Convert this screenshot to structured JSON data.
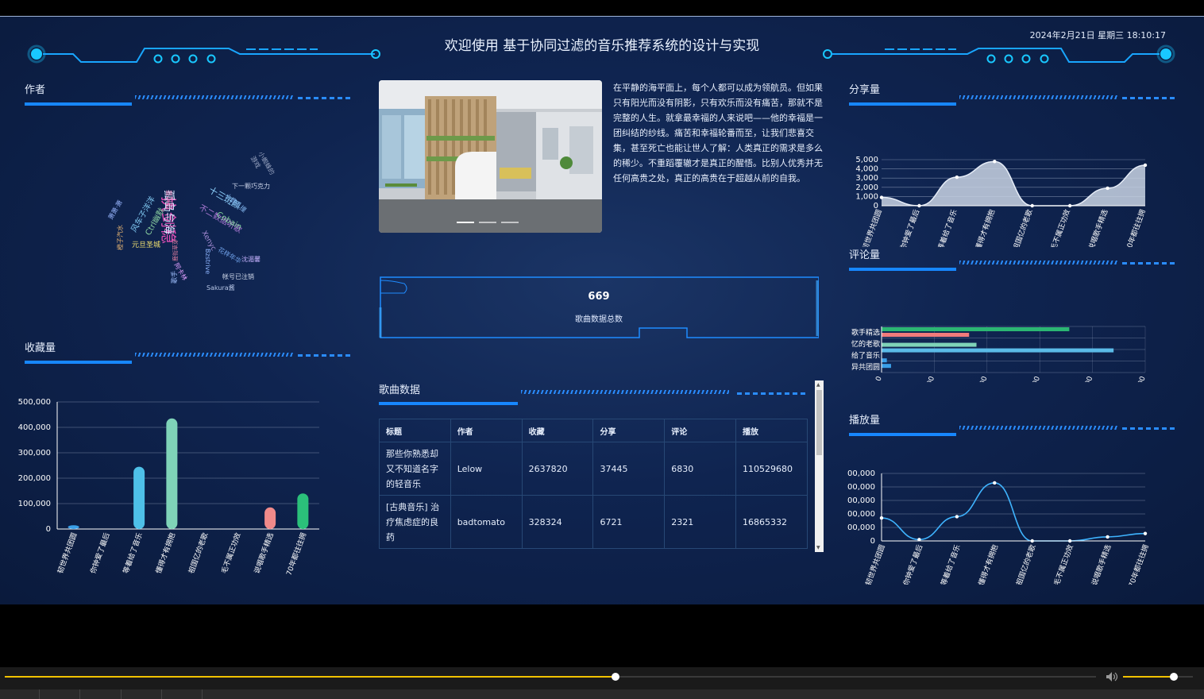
{
  "header": {
    "title": "欢迎使用 基于协同过滤的音乐推荐系统的设计与实现",
    "datetime": "2024年2月21日 星期三 18:10:17"
  },
  "panels": {
    "author": "作者",
    "favorites": "收藏量",
    "shares": "分享量",
    "comments": "评论量",
    "plays": "播放量",
    "song_data": "歌曲数据"
  },
  "description": "在平静的海平面上，每个人都可以成为领航员。但如果只有阳光而没有阴影，只有欢乐而没有痛苦，那就不是完整的人生。就拿最幸福的人来说吧——他的幸福是一团纠结的纱线。痛苦和幸福轮番而至，让我们悲喜交集，甚至死亡也能让世人了解：人类真正的需求是多么的稀少。不重蹈覆辙才是真正的醒悟。比别人优秀并无任何高贵之处，真正的高贵在于超越从前的自我。",
  "counter": {
    "value": "669",
    "label": "歌曲数据总数"
  },
  "word_cloud": [
    {
      "text": "执剑稳",
      "color": "#e04fb5"
    },
    {
      "text": "孤岛与海",
      "color": "#d8e4ff"
    },
    {
      "text": "十三斑颜",
      "color": "#8fd3ff"
    },
    {
      "text": "不二数据听歌",
      "color": "#b07cd8"
    },
    {
      "text": "Cobain",
      "color": "#7fd39a"
    },
    {
      "text": "下一颗巧克力",
      "color": "#c9d2e8"
    },
    {
      "text": "小蜘蛛的游戏",
      "color": "#9aa6c2"
    },
    {
      "text": "小鹿乱撞",
      "color": "#7db0e8"
    },
    {
      "text": "鹿衔草芽",
      "color": "#e07da0"
    },
    {
      "text": "Xenyc",
      "color": "#a98ed8"
    },
    {
      "text": "Bzstrive",
      "color": "#8fb6ff"
    },
    {
      "text": "花样年华",
      "color": "#6fa0e8"
    },
    {
      "text": "沈湄馨",
      "color": "#c6b3ff"
    },
    {
      "text": "帐号已注销",
      "color": "#cfd8ea"
    },
    {
      "text": "Sakura酱",
      "color": "#b7c6e6"
    },
    {
      "text": "阿卡林",
      "color": "#e0a0ff"
    },
    {
      "text": "元旦圣城",
      "color": "#f0e070"
    },
    {
      "text": "Ctrl幽默",
      "color": "#8ad0a0"
    },
    {
      "text": "风车子洋洋",
      "color": "#7fc7f0"
    },
    {
      "text": "萧萧·萧",
      "color": "#9ab7ff"
    },
    {
      "text": "橙子汽水",
      "color": "#e0b070"
    },
    {
      "text": "阿拉蕾",
      "color": "#e590c0"
    },
    {
      "text": "歌手",
      "color": "#a0c0ff"
    }
  ],
  "table": {
    "headers": [
      "标题",
      "作者",
      "收藏",
      "分享",
      "评论",
      "播放"
    ],
    "rows": [
      [
        "那些你熟悉却又不知道名字的轻音乐",
        "Lelow",
        "2637820",
        "37445",
        "6830",
        "110529680"
      ],
      [
        "[古典音乐] 治疗焦虑症的良药",
        "badtomato",
        "328324",
        "6721",
        "2321",
        "16865332"
      ]
    ]
  },
  "colors": {
    "accent": "#1787ff",
    "cyan": "#19c8ff",
    "bg": "#0f2450"
  },
  "chart_data": [
    {
      "type": "area",
      "name": "shares",
      "categories": [
        "韧世界共团圆",
        "你钟爱了最后",
        "等着给了音乐",
        "懂得才有拥抱",
        "祖国亿的老歌",
        "毛不属正功效",
        "说唱歌手精选",
        "70年都往往拥"
      ],
      "values": [
        900,
        0,
        3100,
        4800,
        0,
        0,
        1900,
        4400
      ],
      "y_ticks": [
        "5,000",
        "4,000",
        "3,000",
        "2,000",
        "1,000",
        "0"
      ],
      "ylim": [
        0,
        5000
      ],
      "grid": true
    },
    {
      "type": "bar",
      "name": "comments",
      "orientation": "horizontal",
      "categories": [
        "歌手精选",
        "忆的老歌",
        "给了音乐",
        "异共团圆"
      ],
      "series": [
        {
          "values": [
            1780,
            830
          ],
          "colors": [
            "#2bb673",
            "#f07b7b"
          ]
        },
        {
          "values": [
            900,
            2200
          ],
          "colors": [
            "#7fd3b8",
            "#5bbbe8"
          ]
        },
        {
          "values": [
            50,
            90
          ],
          "colors": [
            "#3a9fe8",
            "#3a9fe8"
          ]
        }
      ],
      "x_ticks": [
        "0",
        "500",
        "1,000",
        "1,500",
        "2,000",
        "2,500"
      ],
      "xlim": [
        0,
        2500
      ],
      "grid": true
    },
    {
      "type": "bar",
      "name": "favorites",
      "categories": [
        "韧世界共团圆",
        "你钟爱了最后",
        "等着给了音乐",
        "懂得才有拥抱",
        "祖国亿的老歌",
        "毛不属正功效",
        "说唱歌手精选",
        "70年都往往拥"
      ],
      "values": [
        15000,
        0,
        245000,
        435000,
        0,
        0,
        85000,
        140000
      ],
      "bar_colors": [
        "#3a9fe8",
        "#3a9fe8",
        "#4ec0e8",
        "#7fd3b8",
        "#3a9fe8",
        "#3a9fe8",
        "#f08a8a",
        "#2bc07a"
      ],
      "y_ticks": [
        "500,000",
        "400,000",
        "300,000",
        "200,000",
        "100,000",
        "0"
      ],
      "ylim": [
        0,
        500000
      ],
      "grid": true
    },
    {
      "type": "line",
      "name": "plays",
      "categories": [
        "韧世界共团圆",
        "你钟爱了最后",
        "等着给了音乐",
        "懂得才有拥抱",
        "祖国亿的老歌",
        "毛不属正功效",
        "说唱歌手精选",
        "70年都往往拥"
      ],
      "values": [
        170000,
        10000,
        180000,
        430000,
        0,
        0,
        30000,
        55000
      ],
      "y_ticks": [
        "00,000",
        "00,000",
        "00,000",
        "00,000",
        "00,000",
        "0"
      ],
      "ylim": [
        0,
        500000
      ],
      "grid": true
    }
  ],
  "player": {
    "progress": 0.56,
    "volume": 0.73
  }
}
